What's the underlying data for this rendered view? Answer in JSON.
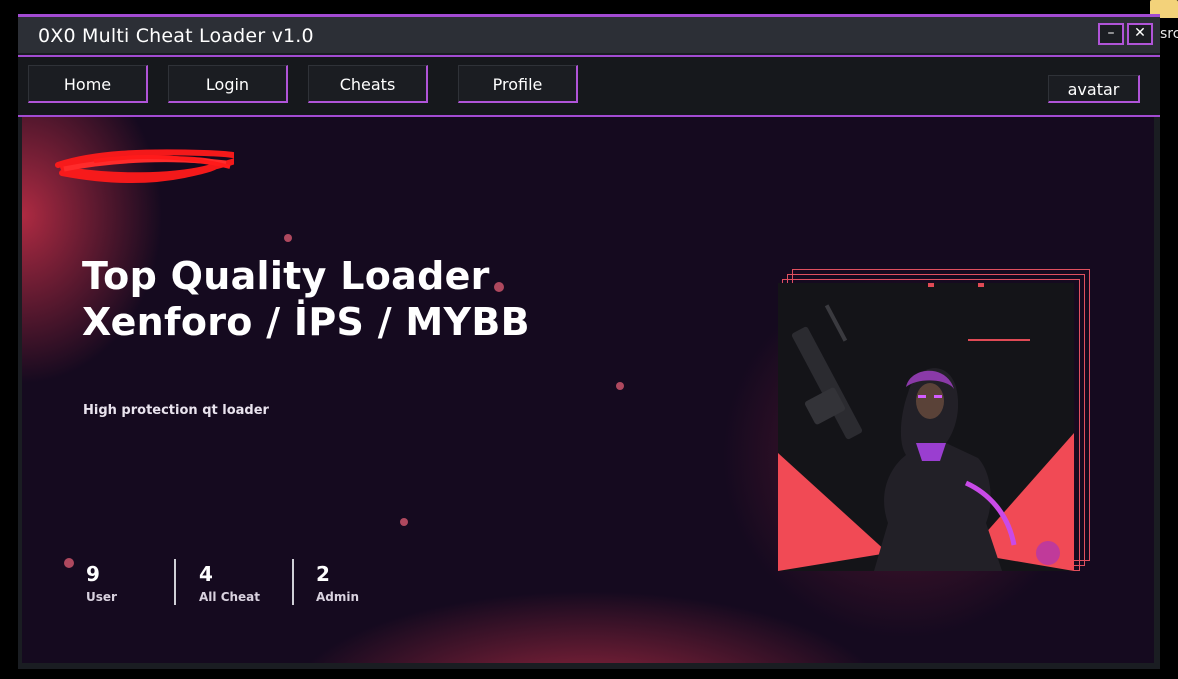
{
  "window": {
    "title": "0X0 Multi Cheat Loader v1.0",
    "minimize_label": "–",
    "close_label": "✕"
  },
  "nav": {
    "items": [
      "Home",
      "Login",
      "Cheats",
      "Profile"
    ],
    "avatar_label": "avatar"
  },
  "hero": {
    "headline_line1": "Top Quality Loader",
    "headline_line2": "Xenforo / İPS / MYBB",
    "subtitle": "High protection qt loader"
  },
  "stats": [
    {
      "value": "9",
      "label": "User"
    },
    {
      "value": "4",
      "label": "All Cheat"
    },
    {
      "value": "2",
      "label": "Admin"
    }
  ],
  "desktop": {
    "icon_label": "src"
  },
  "colors": {
    "accent": "#b054d8",
    "hero_bg": "#150a1f",
    "glow": "#d03a55",
    "card_red": "#f14a55"
  }
}
